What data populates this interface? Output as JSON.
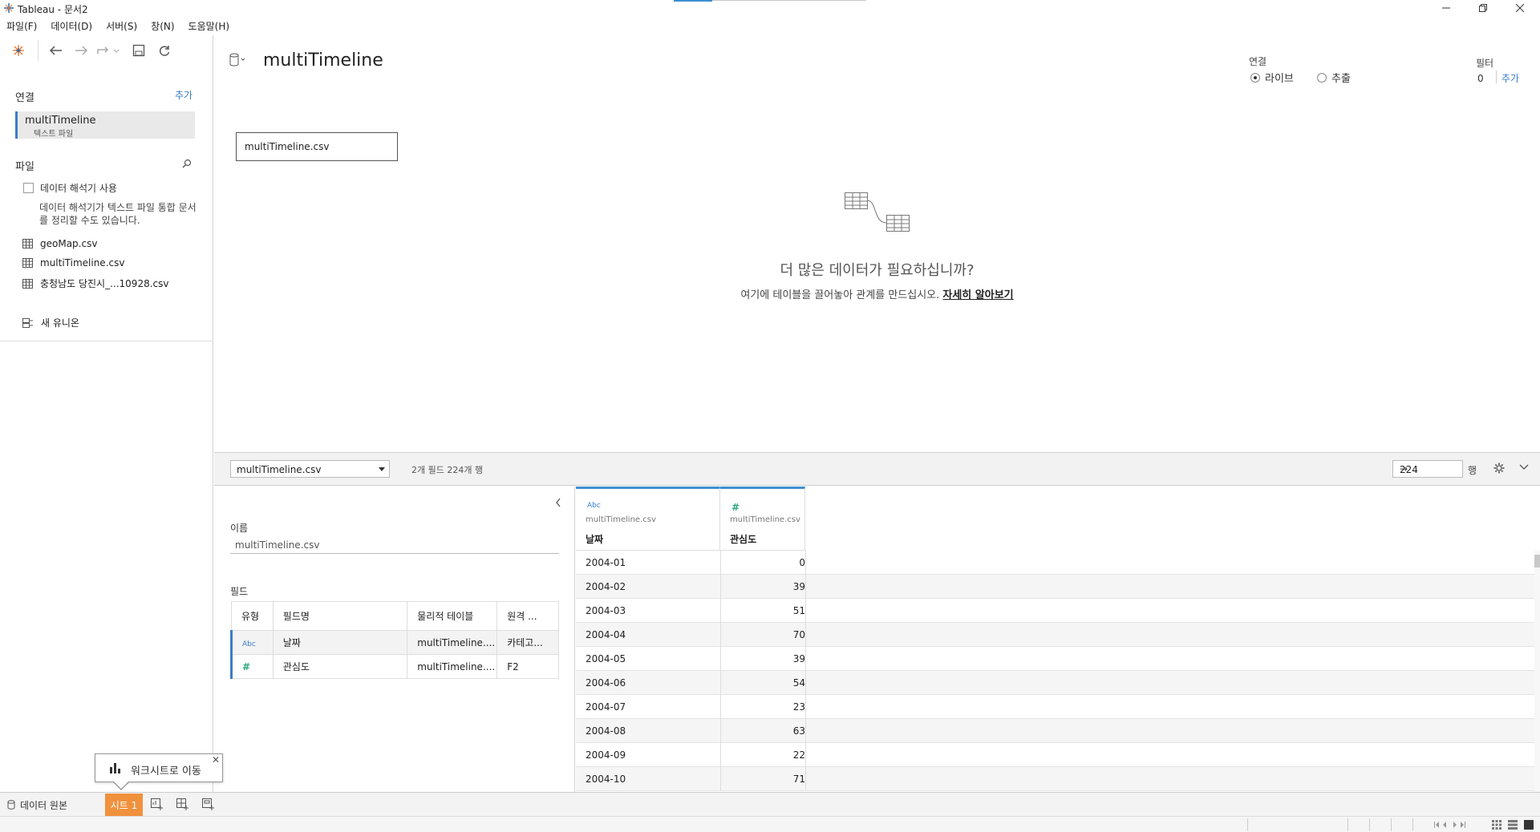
{
  "window": {
    "title": "Tableau - 문서2"
  },
  "menu": [
    "파일(F)",
    "데이터(D)",
    "서버(S)",
    "창(N)",
    "도움말(H)"
  ],
  "sidebar": {
    "connections_title": "연결",
    "add_label": "추가",
    "connection": {
      "name": "multiTimeline",
      "type": "텍스트 파일"
    },
    "files_title": "파일",
    "interpreter_label": "데이터 해석기 사용",
    "interpreter_help": "데이터 해석기가 텍스트 파일 통합 문서를 정리할 수도 있습니다.",
    "files": [
      "geoMap.csv",
      "multiTimeline.csv",
      "충청남도 당진시_...10928.csv"
    ],
    "new_union": "새 유니온"
  },
  "canvas": {
    "title": "multiTimeline",
    "connection_label": "연결",
    "radio_live": "라이브",
    "radio_extract": "추출",
    "filter_label": "필터",
    "filter_count": "0",
    "filter_add": "추가",
    "table_name": "multiTimeline.csv",
    "more_title": "더 많은 데이터가 필요하십니까?",
    "more_sub": "여기에 테이블을 끌어놓아 관계를 만드십시오.",
    "more_link": "자세히 알아보기"
  },
  "bottom": {
    "table_select": "multiTimeline.csv",
    "summary": "2개 필드 224개 행",
    "rows_value": "224",
    "rows_label": "행"
  },
  "meta": {
    "name_label": "이름",
    "name_value": "multiTimeline.csv",
    "fields_label": "필드",
    "columns": [
      "유형",
      "필드명",
      "물리적 테이블",
      "원격 ..."
    ],
    "rows": [
      {
        "type": "Abc",
        "name": "날짜",
        "table": "multiTimeline....",
        "remote": "카테고..."
      },
      {
        "type": "#",
        "name": "관심도",
        "table": "multiTimeline....",
        "remote": "F2"
      }
    ]
  },
  "grid": {
    "columns": [
      {
        "type": "Abc",
        "source": "multiTimeline.csv",
        "name": "날짜"
      },
      {
        "type": "#",
        "source": "multiTimeline.csv",
        "name": "관심도"
      }
    ],
    "rows": [
      [
        "2004-01",
        "0"
      ],
      [
        "2004-02",
        "39"
      ],
      [
        "2004-03",
        "51"
      ],
      [
        "2004-04",
        "70"
      ],
      [
        "2004-05",
        "39"
      ],
      [
        "2004-06",
        "54"
      ],
      [
        "2004-07",
        "23"
      ],
      [
        "2004-08",
        "63"
      ],
      [
        "2004-09",
        "22"
      ],
      [
        "2004-10",
        "71"
      ]
    ]
  },
  "tooltip": {
    "text": "워크시트로 이동",
    "close": "✕"
  },
  "tabs": {
    "datasource": "데이터 원본",
    "sheet1": "시트 1"
  },
  "colors": {
    "accent": "#3a7dc9",
    "sheet_tab": "#f0913d",
    "number_type": "#2aa87a"
  }
}
